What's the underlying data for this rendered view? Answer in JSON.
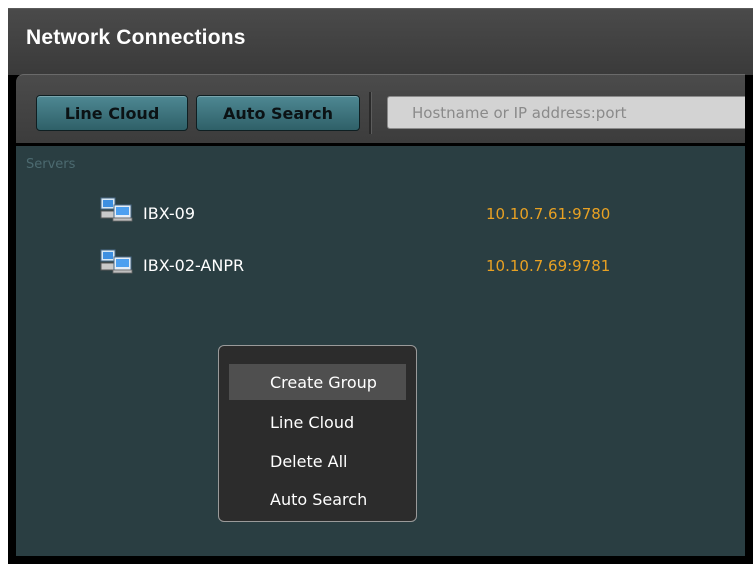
{
  "window": {
    "title": "Network Connections"
  },
  "toolbar": {
    "line_cloud_label": "Line Cloud",
    "auto_search_label": "Auto Search",
    "search_placeholder": "Hostname or IP address:port"
  },
  "servers": {
    "section_label": "Servers",
    "items": [
      {
        "name": "IBX-09",
        "address": "10.10.7.61:9780",
        "icon": "server-icon"
      },
      {
        "name": "IBX-02-ANPR",
        "address": "10.10.7.69:9781",
        "icon": "server-icon"
      }
    ]
  },
  "context_menu": {
    "items": [
      {
        "label": "Create Group",
        "highlighted": true
      },
      {
        "label": "Line Cloud",
        "highlighted": false
      },
      {
        "label": "Delete All",
        "highlighted": false
      },
      {
        "label": "Auto Search",
        "highlighted": false
      }
    ]
  },
  "colors": {
    "accent_button": "#3f7480",
    "address_text": "#e8a123",
    "panel_background": "#2a3e42"
  }
}
